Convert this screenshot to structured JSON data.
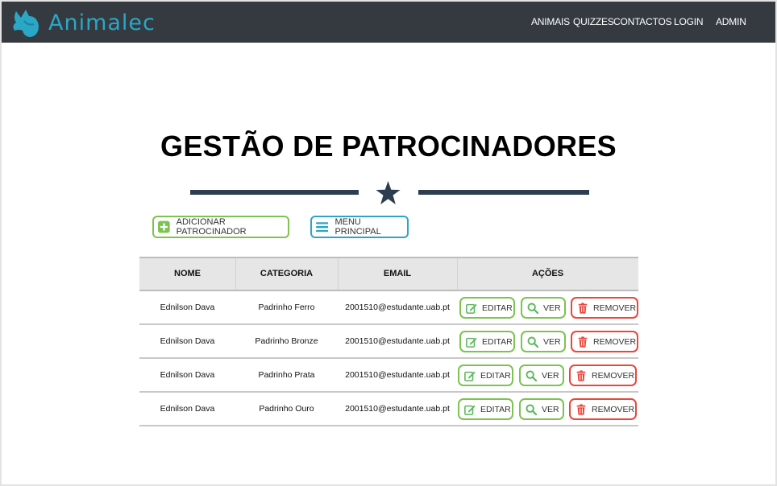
{
  "app": {
    "name": "Animalec",
    "brand_color": "#2aa7c7"
  },
  "nav": {
    "links": [
      "ANIMAIS",
      "QUIZZES",
      "CONTACTOS",
      "LOGIN",
      "ADMIN"
    ]
  },
  "page": {
    "title": "GESTÃO DE PATROCINADORES",
    "divider_icon": "star-icon"
  },
  "actions": {
    "add_label": "ADICIONAR PATROCINADOR",
    "add_icon": "plus-square-icon",
    "menu_label": "MENU PRINCIPAL",
    "menu_icon": "hamburger-menu-icon"
  },
  "table": {
    "headers": [
      "NOME",
      "CATEGORIA",
      "EMAIL",
      "AÇÕES"
    ],
    "rows": [
      {
        "nome": "Ednilson Dava",
        "categoria": "Padrinho Ferro",
        "email": "2001510@estudante.uab.pt"
      },
      {
        "nome": "Ednilson Dava",
        "categoria": "Padrinho Bronze",
        "email": "2001510@estudante.uab.pt"
      },
      {
        "nome": "Ednilson Dava",
        "categoria": "Padrinho Prata",
        "email": "2001510@estudante.uab.pt"
      },
      {
        "nome": "Ednilson Dava",
        "categoria": "Padrinho Ouro",
        "email": "2001510@estudante.uab.pt"
      }
    ],
    "row_actions": {
      "edit_label": "EDITAR",
      "view_label": "VER",
      "remove_label": "REMOVER",
      "edit_icon": "edit-icon",
      "view_icon": "search-icon",
      "remove_icon": "trash-icon"
    }
  },
  "colors": {
    "navbar": "#343a40",
    "green_outline": "#7cc34f",
    "blue_outline": "#2ea3c9",
    "red_outline": "#e9473b",
    "accent_dark": "#2c3e50"
  }
}
